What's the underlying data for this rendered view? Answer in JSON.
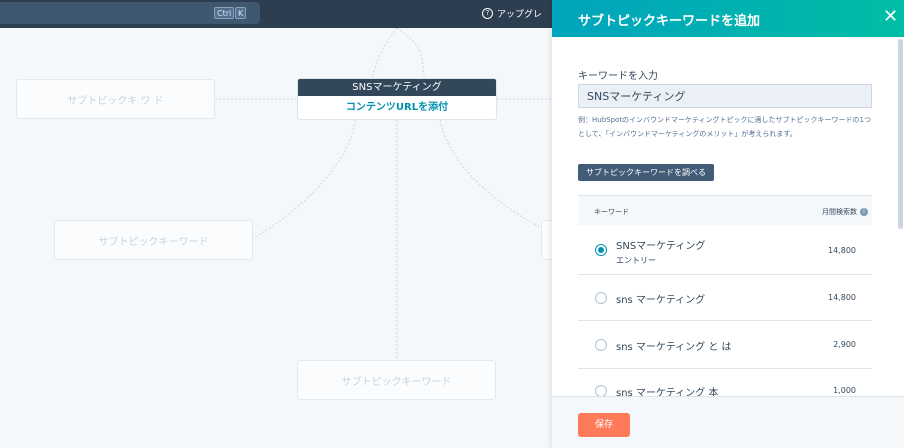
{
  "topbar": {
    "kbd_ctrl": "Ctrl",
    "kbd_k": "K",
    "upgrade_label": "アップグレ"
  },
  "canvas": {
    "center_title": "SNSマーケティング",
    "center_link": "コンテンツURLを添付",
    "node_top_left": "サブトピックキ ワ ド",
    "node_mid_left": "サブトピックキーワード",
    "node_bottom": "サブトピックキーワード"
  },
  "panel": {
    "title": "サブトピックキーワードを追加",
    "input_label": "キーワードを入力",
    "input_value": "SNSマーケティング",
    "help_text": "例：HubSpotのインバウンドマーケティングトピックに適したサブトピックキーワードの1つとして、「インバウンドマーケティングのメリット」が考えられます。",
    "suggest_button": "サブトピックキーワードを調べる",
    "table": {
      "col_keyword": "キーワード",
      "col_volume": "月間検索数",
      "rows": [
        {
          "keyword": "SNSマーケティング",
          "tag": "エントリー",
          "volume": "14,800",
          "selected": true
        },
        {
          "keyword": "sns マーケティング",
          "volume": "14,800",
          "selected": false
        },
        {
          "keyword": "sns マーケティング と は",
          "volume": "2,900",
          "selected": false
        },
        {
          "keyword": "sns マーケティング 本",
          "volume": "1,000",
          "selected": false
        }
      ]
    },
    "save_button": "保存"
  }
}
